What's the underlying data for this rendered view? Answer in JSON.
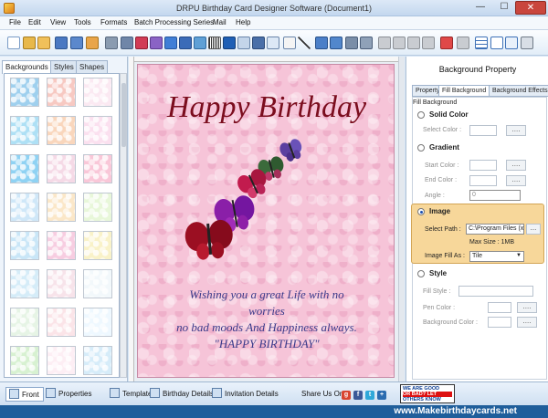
{
  "window": {
    "title": "DRPU Birthday Card Designer Software (Document1)",
    "min": "—",
    "max": "☐",
    "close": "✕"
  },
  "menu": [
    "File",
    "Edit",
    "View",
    "Tools",
    "Formats",
    "Batch Processing Series",
    "Mail",
    "Help"
  ],
  "toolbar_icons": [
    "new-icon",
    "open-icon",
    "open-template-icon",
    "save-icon",
    "save-as-icon",
    "export-icon",
    "print-icon",
    "print-preview-icon",
    "copy-icon",
    "paste-icon",
    "pencil-icon",
    "brush-icon",
    "wordart-icon",
    "barcode-icon",
    "text-icon",
    "image-icon",
    "signature-icon",
    "email-icon",
    "line-icon",
    "book-icon",
    "library-icon",
    "undo-icon",
    "redo-icon",
    "copy2-icon",
    "paste2-icon",
    "cut-icon",
    "delete-icon",
    "front-icon",
    "back-icon",
    "grid-icon",
    "zoom-fit-icon",
    "zoom-icon",
    "settings-icon"
  ],
  "left_panel": {
    "tabs": [
      "Backgrounds",
      "Styles",
      "Shapes"
    ],
    "thumb_colors": [
      "#9fd0ee",
      "#f7c9c2",
      "#fbe9f2",
      "#aee0f5",
      "#f9d6bc",
      "#fbe0ef",
      "#8fd2f3",
      "#f5d9e6",
      "#f9c7d8",
      "#cfe7f8",
      "#fbe7c8",
      "#e8f7d9",
      "#c9e6f7",
      "#f7cde1",
      "#f9f2c8",
      "#d5ecf8",
      "#f7e3ea",
      "#f2f8fb",
      "#e6f4e5",
      "#fbe4e8",
      "#eef8ff",
      "#d7f1d1",
      "#fdeef4",
      "#d6ecf9"
    ]
  },
  "card": {
    "title": "Happy Birthday",
    "line1": "Wishing you a great Life with no",
    "line2": "worries",
    "line3": "no bad moods And Happiness always.",
    "line4": "\"HAPPY BIRTHDAY\""
  },
  "right_panel": {
    "title": "Background Property",
    "tabs": [
      "Property",
      "Fill Background",
      "Background Effects"
    ],
    "fill_background_label": "Fill Background",
    "solid_color": {
      "label": "Solid Color",
      "select_color": "Select Color :",
      "btn": "...."
    },
    "gradient": {
      "label": "Gradient",
      "start": "Start Color :",
      "end": "End Color :",
      "angle": "Angle :",
      "angle_value": "0",
      "btn": "...."
    },
    "image": {
      "label": "Image",
      "select_path": "Select Path :",
      "path_value": "C:\\Program Files (x86",
      "btn": "...",
      "max_size": "Max Size : 1MB",
      "fill_as": "Image Fill As :",
      "fill_value": "Tile"
    },
    "style": {
      "label": "Style",
      "fill_style": "Fill Style :",
      "pen_color": "Pen Color :",
      "bg_color": "Background Color :",
      "btn": "...."
    }
  },
  "bottom": {
    "front": "Front",
    "properties": "Properties",
    "templates": "Templates",
    "birthday_details": "Birthday Details",
    "invitation_details": "Invitation Details",
    "share": "Share Us On :",
    "feedback_line1": "WE ARE GOOD",
    "feedback_line2": "OR BAD? LET",
    "feedback_line3": "OTHERS KNOW"
  },
  "website": "www.Makebirthdaycards.net"
}
